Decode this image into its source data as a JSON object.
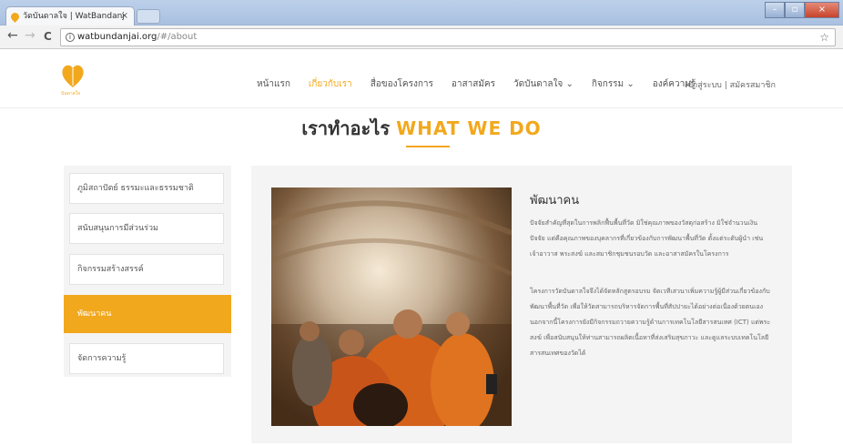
{
  "browser": {
    "tab_title": "วัดบันดาลใจ | WatBandanj",
    "tab_close": "×",
    "url_host": "watbundanjai.org",
    "url_path": "/#/about",
    "back": "←",
    "forward": "→",
    "reload": "C",
    "info": "i",
    "bookmark": "☆",
    "win_min": "–",
    "win_max": "▫",
    "win_close": "×"
  },
  "site": {
    "logo_text": "บันดาลใจ",
    "menu": [
      {
        "label": "หน้าแรก"
      },
      {
        "label": "เกี่ยวกับเรา"
      },
      {
        "label": "สื่อของโครงการ"
      },
      {
        "label": "อาสาสมัคร"
      },
      {
        "label": "วัดบันดาลใจ ⌄"
      },
      {
        "label": "กิจกรรม ⌄"
      },
      {
        "label": "องค์ความรู้"
      }
    ],
    "login": "เข้าสู่ระบบ | สมัครสมาชิก",
    "accent_color": "#f2a81d"
  },
  "main": {
    "heading_th": "เราทำอะไร",
    "heading_en": "WHAT WE DO",
    "sidebar": [
      {
        "label": "ภูมิสถาปัตย์ ธรรมะและธรรมชาติ"
      },
      {
        "label": "สนับสนุนการมีส่วนร่วม"
      },
      {
        "label": "กิจกรรมสร้างสรรค์"
      },
      {
        "label": "พัฒนาคน"
      },
      {
        "label": "จัดการความรู้"
      }
    ],
    "active_index": 3,
    "article": {
      "title": "พัฒนาคน",
      "paragraph1": "ปัจจัยสำคัญที่สุดในการพลิกฟื้นพื้นที่วัด มิใช่คุณภาพของวัสดุก่อสร้าง มิใช่จำนวนเงินปัจจัย แต่คือคุณภาพของบุคลากรที่เกี่ยวข้องกับการพัฒนาพื้นที่วัด ตั้งแต่ระดับผู้นำ เช่น เจ้าอาวาส พระสงฆ์ และสมาชิกชุมชนรอบวัด และอาสาสมัครในโครงการ",
      "paragraph2": "โครงการวัดบันดาลใจจึงได้จัดหลักสูตรอบรม จัดเวทีเสวนาเพิ่มความรู้ผู้มีส่วนเกี่ยวข้องกับพัฒนาพื้นที่วัด เพื่อให้วัดสามารถบริหารจัดการพื้นที่สัปปายะได้อย่างต่อเนื่องด้วยตนเอง นอกจากนี้โครงการยังมีกิจกรรมถวายความรู้ด้านการเทคโนโลยีสารสนเทศ (ICT) แด่พระสงฆ์ เพื่อสนับสนุนให้ท่านสามารถผลิตเนื้อหาที่ส่งเสริมสุขภาวะ และดูแลระบบเทคโนโลยีสารสนเทศของวัดได้"
    }
  }
}
